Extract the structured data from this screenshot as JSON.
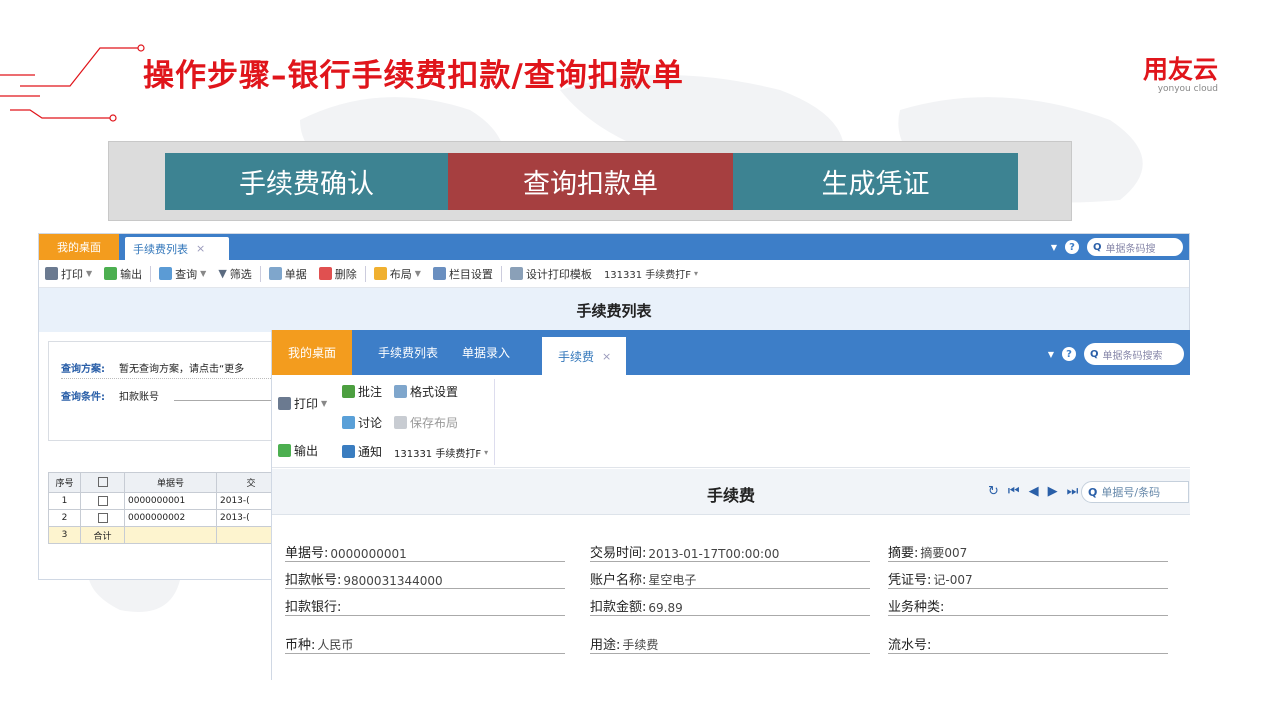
{
  "slide": {
    "title": "操作步骤–银行手续费扣款/查询扣款单",
    "logo_main": "用友云",
    "logo_sub": "yonyou cloud",
    "steps": [
      "手续费确认",
      "查询扣款单",
      "生成凭证"
    ]
  },
  "win1": {
    "tabs": [
      "我的桌面",
      "手续费列表"
    ],
    "search_placeholder": "单据条码搜",
    "toolbar": [
      "打印",
      "输出",
      "查询",
      "筛选",
      "单据",
      "删除",
      "布局",
      "栏目设置",
      "设计打印模板",
      "131331 手续费打F"
    ],
    "list_title": "手续费列表",
    "query_scheme_label": "查询方案:",
    "query_scheme_value": "暂无查询方案，请点击“更多",
    "query_cond_label": "查询条件:",
    "query_cond_value": "扣款账号",
    "grid_headers": [
      "序号",
      "",
      "单据号",
      "交"
    ],
    "grid_rows": [
      [
        "1",
        "",
        "0000000001",
        "2013-("
      ],
      [
        "2",
        "",
        "0000000002",
        "2013-("
      ],
      [
        "3",
        "合计",
        "",
        ""
      ]
    ]
  },
  "win2": {
    "tabs": [
      "我的桌面",
      "手续费列表",
      "单据录入",
      "手续费"
    ],
    "search_placeholder": "单据条码搜索",
    "ribbon": {
      "print": "打印",
      "export": "输出",
      "annotate": "批注",
      "discuss": "讨论",
      "notify": "通知",
      "format": "格式设置",
      "save_layout": "保存布局",
      "template": "131331 手续费打F"
    },
    "form_title": "手续费",
    "nav_search_placeholder": "单据号/条码",
    "fields": {
      "doc_no_label": "单据号:",
      "doc_no": "0000000001",
      "trade_time_label": "交易时间:",
      "trade_time": "2013-01-17T00:00:00",
      "summary_label": "摘要:",
      "summary": "摘要007",
      "account_label": "扣款帐号:",
      "account": "9800031344000",
      "account_name_label": "账户名称:",
      "account_name": "星空电子",
      "voucher_label": "凭证号:",
      "voucher": "记-007",
      "bank_label": "扣款银行:",
      "bank": "",
      "amount_label": "扣款金额:",
      "amount": "69.89",
      "biz_type_label": "业务种类:",
      "biz_type": "",
      "currency_label": "币种:",
      "currency": "人民币",
      "purpose_label": "用途:",
      "purpose": "手续费",
      "serial_label": "流水号:",
      "serial": ""
    }
  }
}
